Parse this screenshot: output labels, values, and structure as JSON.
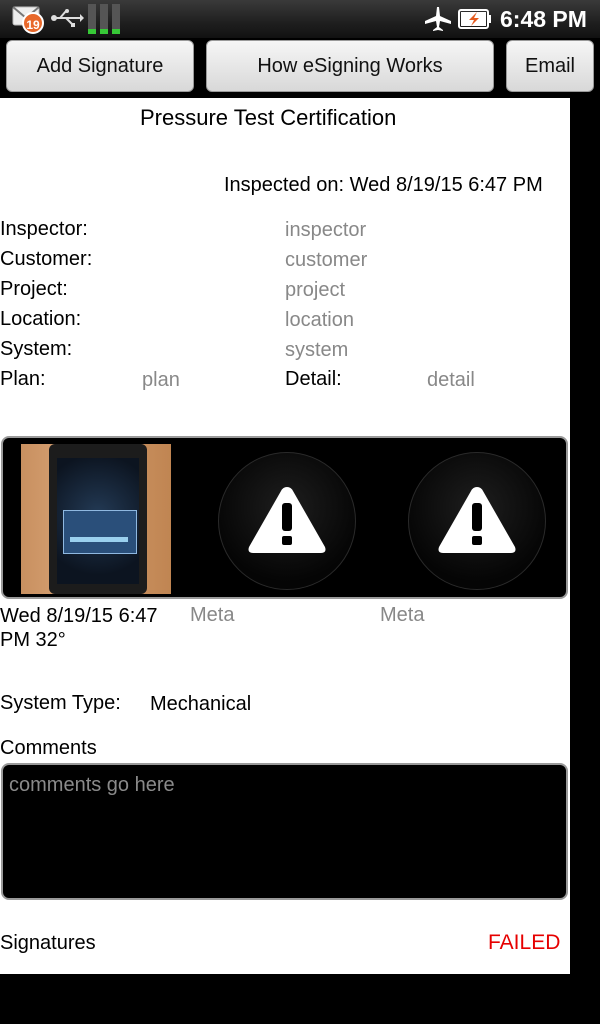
{
  "status_bar": {
    "notification_count": "19",
    "time": "6:48 PM",
    "icons": [
      "mail-icon",
      "usb-icon",
      "signal-icon",
      "airplane-mode-icon",
      "battery-charging-icon"
    ]
  },
  "toolbar": {
    "add_signature_label": "Add Signature",
    "how_esigning_label": "How eSigning Works",
    "email_label": "Email"
  },
  "form": {
    "title": "Pressure Test Certification",
    "inspected_on": "Inspected on: Wed 8/19/15 6:47 PM",
    "fields": {
      "inspector": {
        "label": "Inspector:",
        "value": "inspector"
      },
      "customer": {
        "label": "Customer:",
        "value": "customer"
      },
      "project": {
        "label": "Project:",
        "value": "project"
      },
      "location": {
        "label": "Location:",
        "value": "location"
      },
      "system": {
        "label": "System:",
        "value": "system"
      },
      "plan": {
        "label": "Plan:",
        "value": "plan"
      },
      "detail": {
        "label": "Detail:",
        "value": "detail"
      }
    },
    "photos": {
      "caption_1": "Wed 8/19/15 6:47 PM 32°",
      "caption_2": "Meta",
      "caption_3": "Meta"
    },
    "system_type": {
      "label": "System Type:",
      "value": "Mechanical"
    },
    "comments": {
      "label": "Comments",
      "placeholder": "comments go here"
    },
    "signatures": {
      "label": "Signatures",
      "status": "FAILED",
      "status_color": "#e60000"
    }
  }
}
